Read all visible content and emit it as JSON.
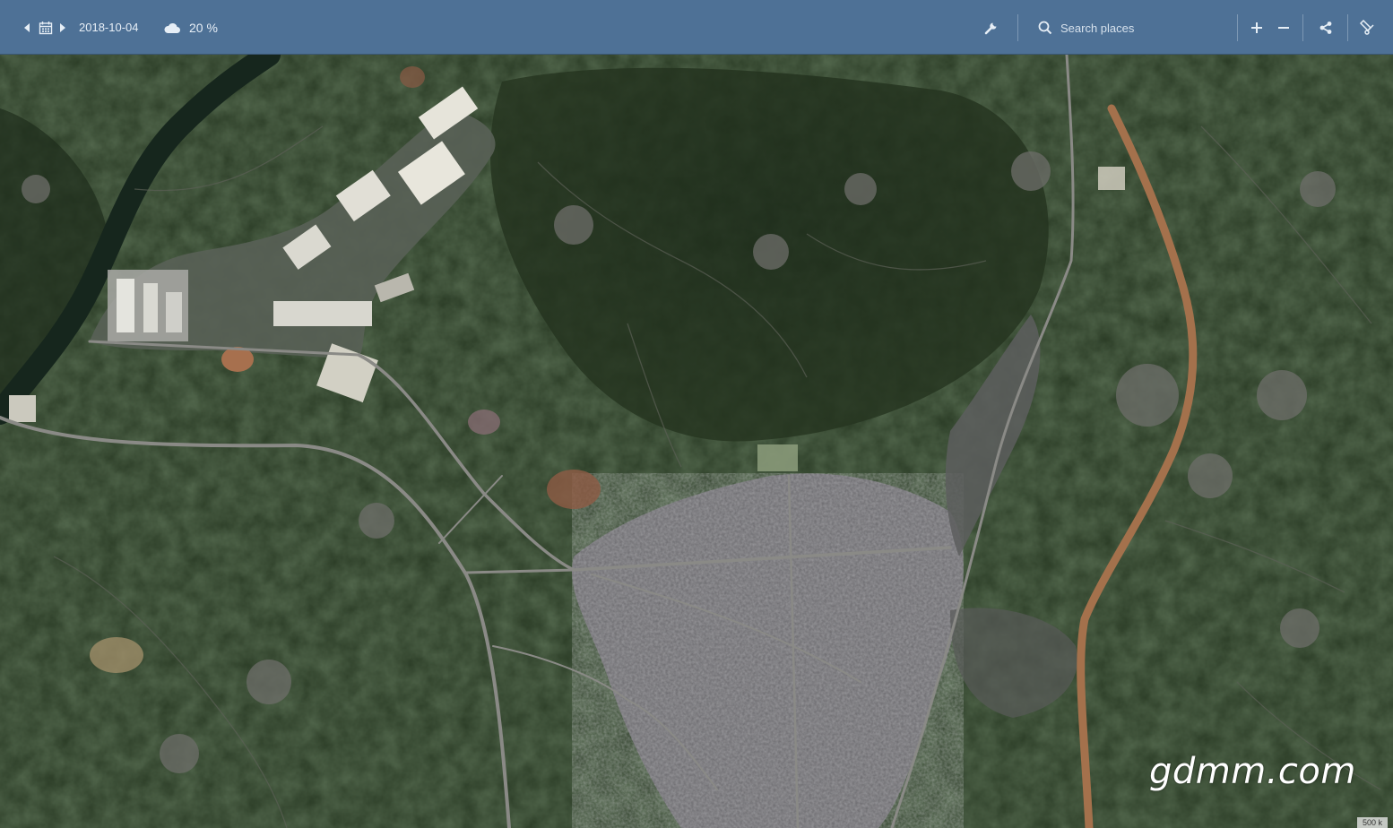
{
  "toolbar": {
    "date": "2018-10-04",
    "cloud_coverage": "20 %",
    "search_placeholder": "Search places",
    "icons": [
      "chevron-left-icon",
      "calendar-icon",
      "chevron-right-icon",
      "cloud-icon",
      "wrench-icon",
      "search-icon",
      "plus-icon",
      "minus-icon",
      "share-icon",
      "measure-icon"
    ]
  },
  "map": {
    "type": "satellite-imagery",
    "colors": {
      "vegetation_dark": "#1f2e1c",
      "vegetation": "#2d3f28",
      "urban": "#6e6e72",
      "industrial_roof": "#dcdcd6",
      "road": "#8a8a86",
      "river_bed": "#a4714c"
    }
  },
  "watermark": "gdmm.com",
  "scale_label": "500 k"
}
